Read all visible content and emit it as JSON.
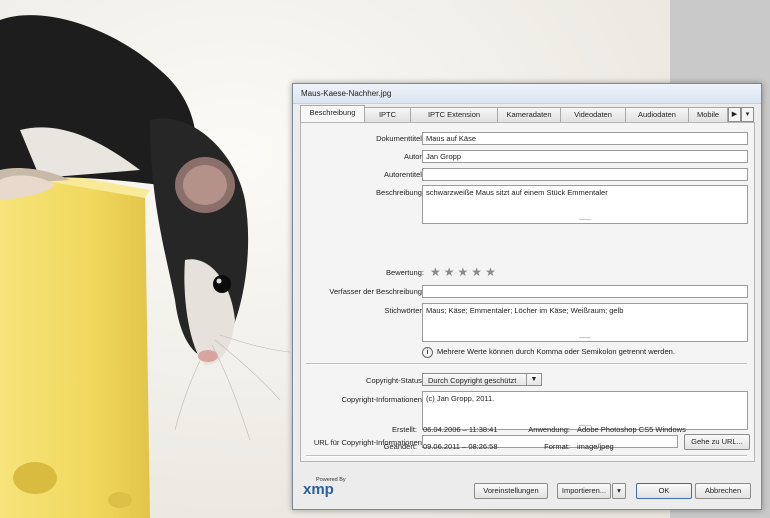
{
  "window": {
    "title": "Maus-Kaese-Nachher.jpg"
  },
  "tabs": [
    "Beschreibung",
    "IPTC",
    "IPTC Extension",
    "Kameradaten",
    "Videodaten",
    "Audiodaten",
    "Mobile"
  ],
  "tab_scroll": {
    "right": "▶",
    "menu": "▾"
  },
  "fields": {
    "dokumenttitel": {
      "label": "Dokumenttitel:",
      "value": "Maus auf Käse"
    },
    "autor": {
      "label": "Autor:",
      "value": "Jan Gropp"
    },
    "autorentitel": {
      "label": "Autorentitel:",
      "value": ""
    },
    "beschreibung": {
      "label": "Beschreibung:",
      "value": "schwarzweiße Maus sitzt auf einem Stück Emmentaler"
    },
    "bewertung": {
      "label": "Bewertung:",
      "stars": 5,
      "filled": 0
    },
    "verfasser": {
      "label": "Verfasser der Beschreibung:",
      "value": ""
    },
    "stichwoerter": {
      "label": "Stichwörter:",
      "value": "Maus; Käse; Emmentaler; Löcher im Käse; Weißraum; gelb"
    }
  },
  "info_note": "Mehrere Werte können durch Komma oder Semikolon getrennt werden.",
  "info_icon": "i",
  "copyright": {
    "status_label": "Copyright-Status:",
    "status_value": "Durch Copyright geschützt",
    "info_label": "Copyright-Informationen:",
    "info_value": "(c) Jan Gropp, 2011.",
    "url_label": "URL für Copyright-Informationen:",
    "url_value": "",
    "goto_url": "Gehe zu URL..."
  },
  "meta": {
    "erstellt_label": "Erstellt:",
    "erstellt_value": "06.04.2006 – 11:38:41",
    "geaendert_label": "Geändert:",
    "geaendert_value": "09.06.2011 – 08:26:58",
    "anwendung_label": "Anwendung:",
    "anwendung_value": "Adobe Photoshop CS5 Windows",
    "format_label": "Format:",
    "format_value": "image/jpeg"
  },
  "footer": {
    "powered_by": "Powered By",
    "xmp": "xmp",
    "voreinstellungen": "Voreinstellungen",
    "importieren": "Importieren...",
    "ok": "OK",
    "abbrechen": "Abbrechen"
  },
  "colors": {
    "cheese": "#f3dd6c",
    "xmp_blue": "#2c5fa0",
    "dialog_border": "#7c8a9a"
  }
}
